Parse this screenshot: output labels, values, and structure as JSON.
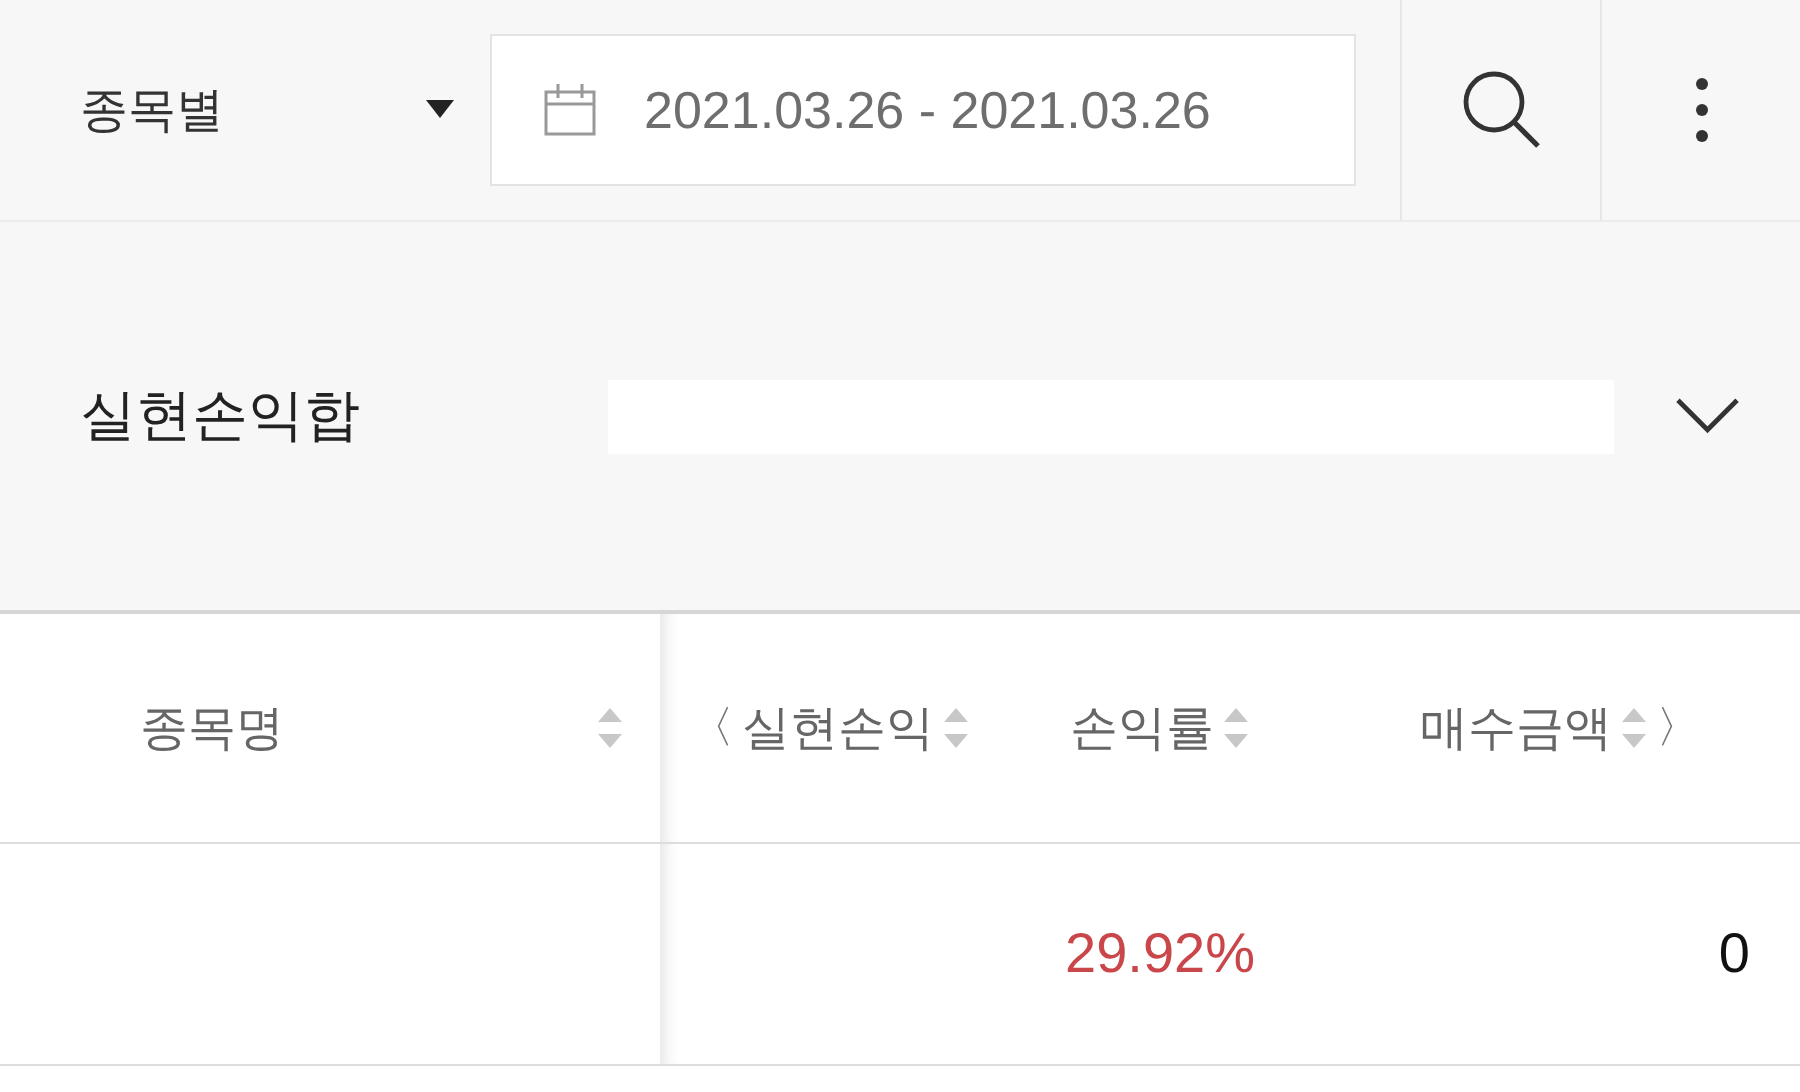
{
  "toolbar": {
    "filter": {
      "label": "종목별"
    },
    "date_range": {
      "value": "2021.03.26 - 2021.03.26"
    }
  },
  "summary": {
    "label": "실현손익합",
    "expanded": false
  },
  "table": {
    "columns": [
      {
        "label": "종목명"
      },
      {
        "label": "실현손익",
        "scroll_left": "〈"
      },
      {
        "label": "손익률"
      },
      {
        "label": "매수금액",
        "scroll_right": "〉"
      }
    ],
    "rows": [
      {
        "profit_rate": "29.92%",
        "purchase_amount": "0"
      }
    ]
  }
}
